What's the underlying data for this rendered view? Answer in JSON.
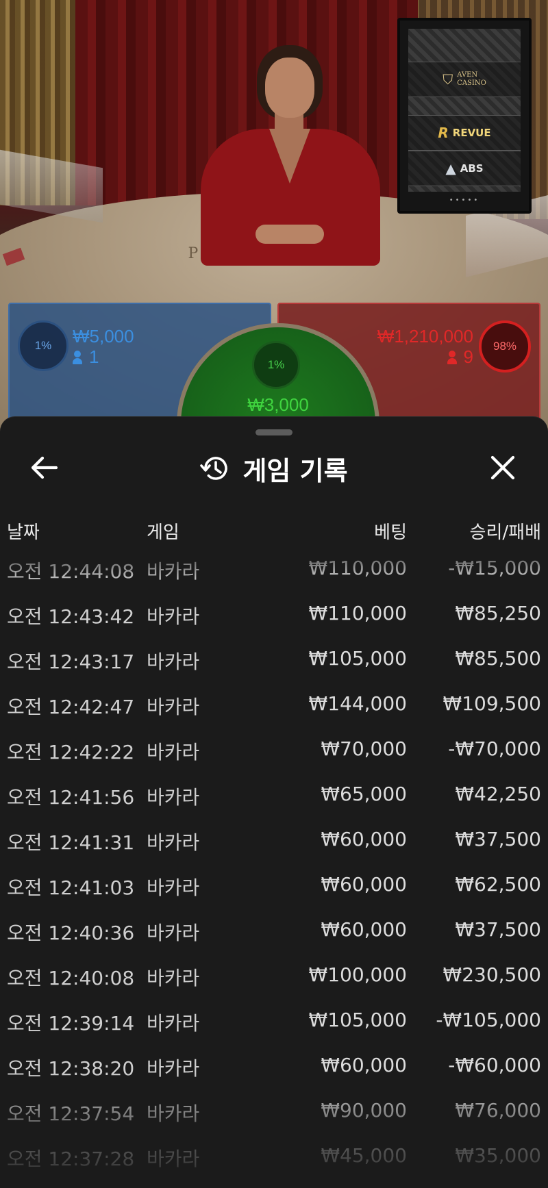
{
  "video": {
    "table_text": "PLAYER        BANKER",
    "brands": {
      "aven": "AVEN\nCASINO",
      "revue": "REVUE",
      "abs": "ABS"
    },
    "panel_dots": "•••••"
  },
  "bets": {
    "player": {
      "percent": "1%",
      "amount": "₩5,000",
      "count": "1",
      "color": "#3b8fe0"
    },
    "tie": {
      "percent": "1%",
      "amount": "₩3,000",
      "color": "#3fd43f"
    },
    "banker": {
      "percent": "98%",
      "amount": "₩1,210,000",
      "count": "9",
      "color": "#e02828"
    }
  },
  "history": {
    "title": "게임 기록",
    "columns": {
      "date": "날짜",
      "game": "게임",
      "bet": "베팅",
      "result": "승리/패배"
    },
    "rows": [
      {
        "time": "오전 12:44:08",
        "game": "바카라",
        "bet": "₩110,000",
        "result": "-₩15,000"
      },
      {
        "time": "오전 12:43:42",
        "game": "바카라",
        "bet": "₩110,000",
        "result": "₩85,250"
      },
      {
        "time": "오전 12:43:17",
        "game": "바카라",
        "bet": "₩105,000",
        "result": "₩85,500"
      },
      {
        "time": "오전 12:42:47",
        "game": "바카라",
        "bet": "₩144,000",
        "result": "₩109,500"
      },
      {
        "time": "오전 12:42:22",
        "game": "바카라",
        "bet": "₩70,000",
        "result": "-₩70,000"
      },
      {
        "time": "오전 12:41:56",
        "game": "바카라",
        "bet": "₩65,000",
        "result": "₩42,250"
      },
      {
        "time": "오전 12:41:31",
        "game": "바카라",
        "bet": "₩60,000",
        "result": "₩37,500"
      },
      {
        "time": "오전 12:41:03",
        "game": "바카라",
        "bet": "₩60,000",
        "result": "₩62,500"
      },
      {
        "time": "오전 12:40:36",
        "game": "바카라",
        "bet": "₩60,000",
        "result": "₩37,500"
      },
      {
        "time": "오전 12:40:08",
        "game": "바카라",
        "bet": "₩100,000",
        "result": "₩230,500"
      },
      {
        "time": "오전 12:39:14",
        "game": "바카라",
        "bet": "₩105,000",
        "result": "-₩105,000"
      },
      {
        "time": "오전 12:38:20",
        "game": "바카라",
        "bet": "₩60,000",
        "result": "-₩60,000"
      },
      {
        "time": "오전 12:37:54",
        "game": "바카라",
        "bet": "₩90,000",
        "result": "₩76,000"
      },
      {
        "time": "오전 12:37:28",
        "game": "바카라",
        "bet": "₩45,000",
        "result": "₩35,000"
      }
    ]
  },
  "icons": {
    "back": "arrow-left-icon",
    "history": "history-clock-icon",
    "close": "close-icon",
    "person": "person-icon"
  }
}
